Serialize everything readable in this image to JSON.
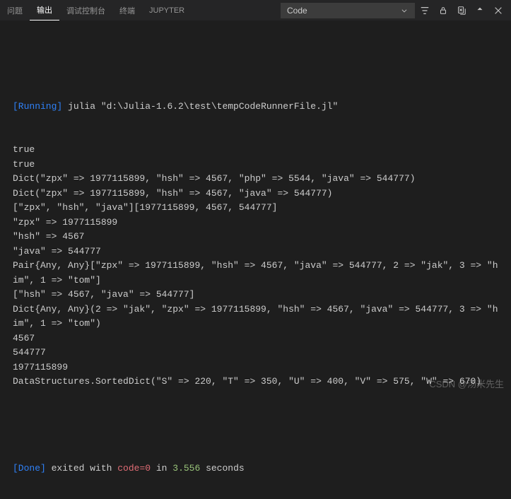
{
  "tabs": {
    "problems": "问题",
    "output": "输出",
    "debug_console": "调试控制台",
    "terminal": "终端",
    "jupyter": "JUPYTER"
  },
  "dropdown": {
    "selected": "Code"
  },
  "output": {
    "running_label": "[Running]",
    "running_cmd": " julia \"d:\\Julia-1.6.2\\test\\tempCodeRunnerFile.jl\"",
    "lines": [
      "true",
      "true",
      "Dict(\"zpx\" => 1977115899, \"hsh\" => 4567, \"php\" => 5544, \"java\" => 544777)",
      "Dict(\"zpx\" => 1977115899, \"hsh\" => 4567, \"java\" => 544777)",
      "[\"zpx\", \"hsh\", \"java\"][1977115899, 4567, 544777]",
      "\"zpx\" => 1977115899",
      "\"hsh\" => 4567",
      "\"java\" => 544777",
      "Pair{Any, Any}[\"zpx\" => 1977115899, \"hsh\" => 4567, \"java\" => 544777, 2 => \"jak\", 3 => \"him\", 1 => \"tom\"]",
      "[\"hsh\" => 4567, \"java\" => 544777]",
      "Dict{Any, Any}(2 => \"jak\", \"zpx\" => 1977115899, \"hsh\" => 4567, \"java\" => 544777, 3 => \"him\", 1 => \"tom\")",
      "4567",
      "544777",
      "1977115899",
      "DataStructures.SortedDict(\"S\" => 220, \"T\" => 350, \"U\" => 400, \"V\" => 575, \"W\" => 670)"
    ],
    "done_label": "[Done]",
    "done_text1": " exited with ",
    "done_code_label": "code=0",
    "done_text2": " in ",
    "done_time": "3.556",
    "done_text3": " seconds"
  },
  "watermark": "CSDN @汤米先生"
}
